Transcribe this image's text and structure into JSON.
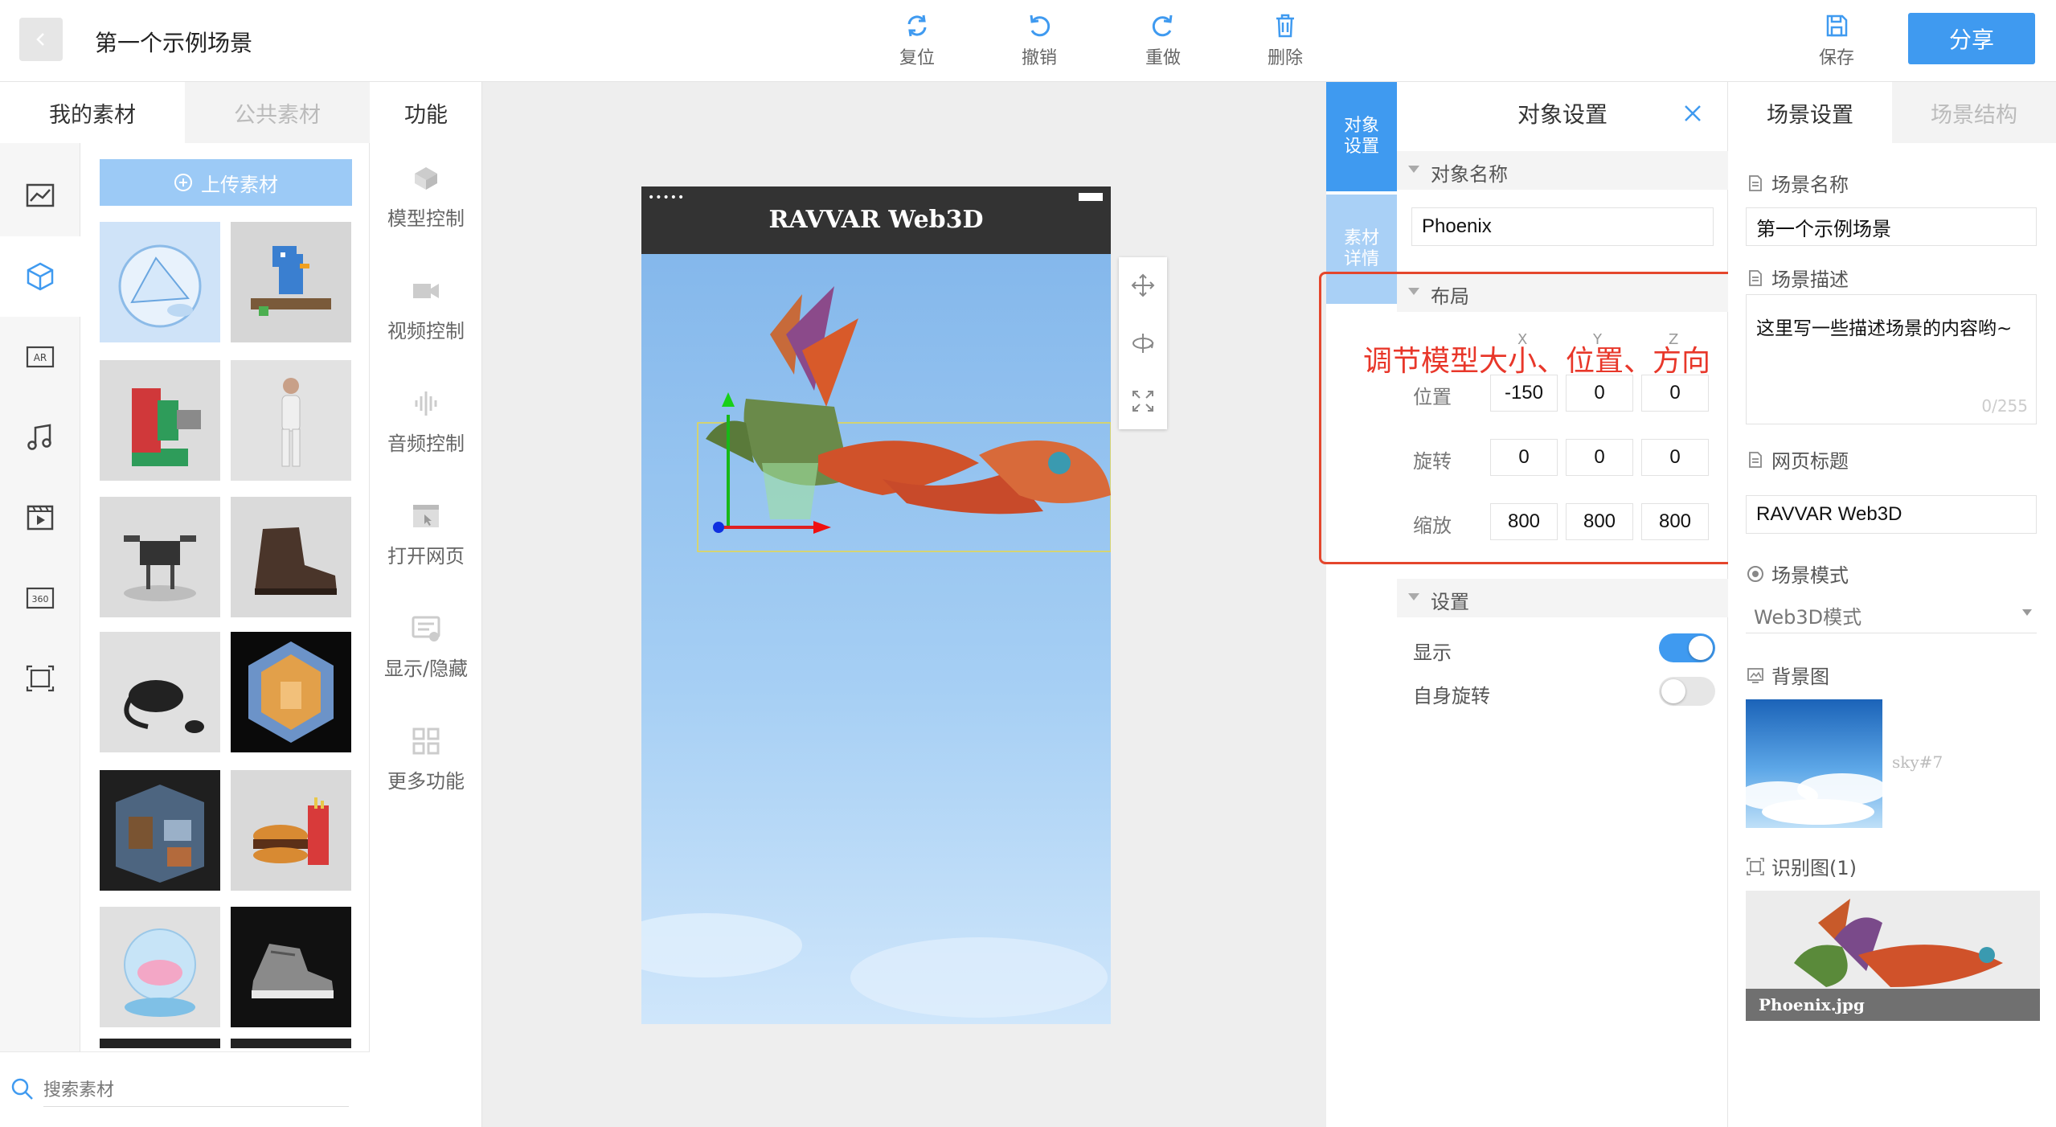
{
  "header": {
    "scene_title": "第一个示例场景",
    "tools": [
      {
        "label": "复位",
        "icon": "reset-icon"
      },
      {
        "label": "撤销",
        "icon": "undo-icon"
      },
      {
        "label": "重做",
        "icon": "redo-icon"
      },
      {
        "label": "删除",
        "icon": "trash-icon"
      }
    ],
    "save_label": "保存",
    "share_label": "分享",
    "accent_color": "#3f9af0"
  },
  "left_panel": {
    "tabs": [
      "我的素材",
      "公共素材"
    ],
    "upload_label": "上传素材",
    "search_placeholder": "搜索素材",
    "rail_icons": [
      "image-chart-icon",
      "cube-icon",
      "ar-icon",
      "music-icon",
      "video-icon",
      "panorama-360-icon",
      "scan-frame-icon"
    ],
    "assets": [
      "glass-tent-model",
      "blue-bird-model",
      "machine-part-model",
      "human-figure-model",
      "drone-model",
      "boot-model",
      "vr-headset-model",
      "room-cube-model",
      "room-diorama-model",
      "burger-fries-model",
      "snow-globe-model",
      "sneaker-model"
    ]
  },
  "functions": {
    "title": "功能",
    "items": [
      {
        "label": "模型控制",
        "icon": "model-control-icon"
      },
      {
        "label": "视频控制",
        "icon": "video-control-icon"
      },
      {
        "label": "音频控制",
        "icon": "audio-control-icon"
      },
      {
        "label": "打开网页",
        "icon": "open-webpage-icon"
      },
      {
        "label": "显示/隐藏",
        "icon": "show-hide-icon"
      },
      {
        "label": "更多功能",
        "icon": "more-functions-icon"
      }
    ]
  },
  "canvas": {
    "phone_status_dots": "•••••",
    "phone_title": "RAVVAR Web3D"
  },
  "object_settings": {
    "side_tabs": [
      "对象\n设置",
      "素材\n详情"
    ],
    "title": "对象设置",
    "name_section": "对象名称",
    "name_value": "Phoenix",
    "layout_section": "布局",
    "axes": [
      "X",
      "Y",
      "Z"
    ],
    "rows": [
      {
        "label": "位置",
        "values": [
          "-150",
          "0",
          "0"
        ]
      },
      {
        "label": "旋转",
        "values": [
          "0",
          "0",
          "0"
        ]
      },
      {
        "label": "缩放",
        "values": [
          "800",
          "800",
          "800"
        ]
      }
    ],
    "settings_section": "设置",
    "toggles": [
      {
        "label": "显示",
        "on": true
      },
      {
        "label": "自身旋转",
        "on": false
      }
    ],
    "annotation": "调节模型大小、位置、方向"
  },
  "scene_settings": {
    "tabs": [
      "场景设置",
      "场景结构"
    ],
    "name_label": "场景名称",
    "name_value": "第一个示例场景",
    "desc_label": "场景描述",
    "desc_value": "这里写一些描述场景的内容哟~",
    "desc_count": "0/255",
    "page_title_label": "网页标题",
    "page_title_value": "RAVVAR Web3D",
    "mode_label": "场景模式",
    "mode_value": "Web3D模式",
    "bg_label": "背景图",
    "bg_name": "sky#7",
    "rec_label": "识别图(1)",
    "rec_caption": "Phoenix.jpg"
  }
}
